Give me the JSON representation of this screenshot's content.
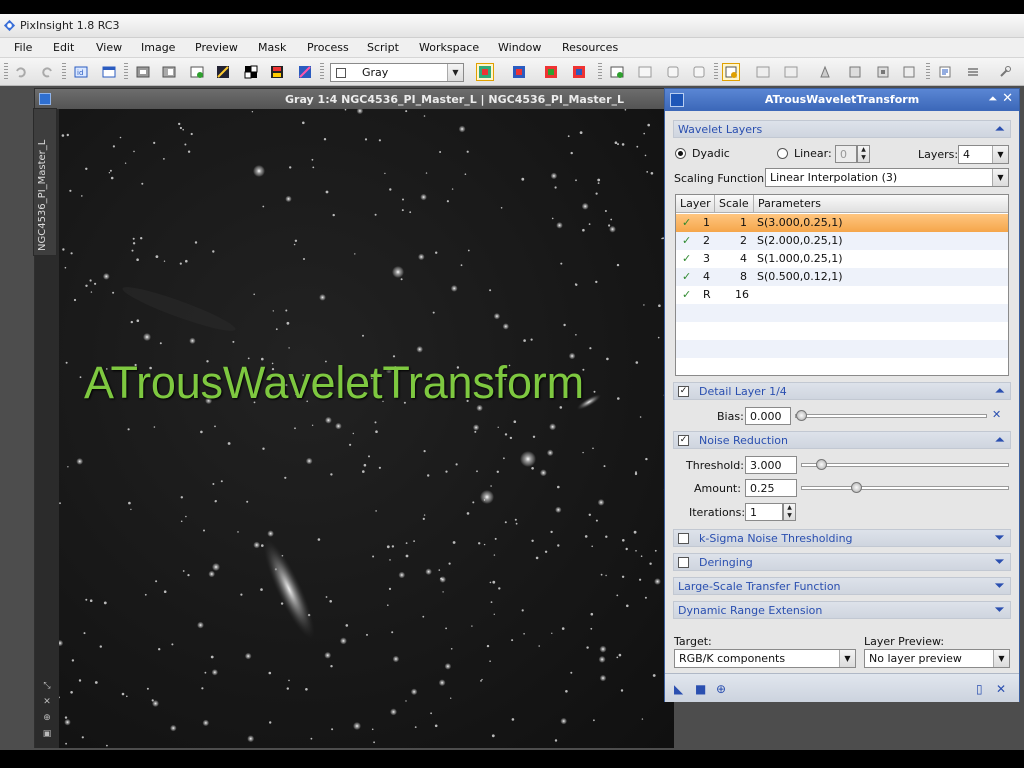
{
  "app": {
    "title": "PixInsight 1.8 RC3"
  },
  "menu": [
    "File",
    "Edit",
    "View",
    "Image",
    "Preview",
    "Mask",
    "Process",
    "Script",
    "Workspace",
    "Window",
    "Resources"
  ],
  "toolbar": {
    "color_mode": "Gray"
  },
  "image_window": {
    "title": "Gray 1:4 NGC4536_PI_Master_L | NGC4536_PI_Master_L",
    "side_tab": "NGC4536_PI_Master_L"
  },
  "overlay_title": "ATrousWaveletTransform",
  "panel": {
    "title": "ATrousWaveletTransform",
    "wavelet_layers": {
      "header": "Wavelet Layers",
      "dyadic_label": "Dyadic",
      "linear_label": "Linear:",
      "linear_value": "0",
      "layers_label": "Layers:",
      "layers_value": "4",
      "scaling_label": "Scaling Function:",
      "scaling_value": "Linear Interpolation (3)",
      "columns": [
        "Layer",
        "Scale",
        "Parameters"
      ],
      "rows": [
        {
          "check": "✓",
          "layer": "1",
          "scale": "1",
          "params": "S(3.000,0.25,1)"
        },
        {
          "check": "✓",
          "layer": "2",
          "scale": "2",
          "params": "S(2.000,0.25,1)"
        },
        {
          "check": "✓",
          "layer": "3",
          "scale": "4",
          "params": "S(1.000,0.25,1)"
        },
        {
          "check": "✓",
          "layer": "4",
          "scale": "8",
          "params": "S(0.500,0.12,1)"
        },
        {
          "check": "✓",
          "layer": "R",
          "scale": "16",
          "params": ""
        }
      ]
    },
    "detail_layer": {
      "header": "Detail Layer 1/4",
      "bias_label": "Bias:",
      "bias_value": "0.000",
      "bias_slider": 0.0
    },
    "noise_reduction": {
      "header": "Noise Reduction",
      "threshold_label": "Threshold:",
      "threshold_value": "3.000",
      "threshold_slider": 0.07,
      "amount_label": "Amount:",
      "amount_value": "0.25",
      "amount_slider": 0.25,
      "iterations_label": "Iterations:",
      "iterations_value": "1"
    },
    "sections": {
      "ksigma": "k-Sigma Noise Thresholding",
      "deringing": "Deringing",
      "large_scale": "Large-Scale Transfer Function",
      "dynamic_range": "Dynamic Range Extension"
    },
    "target_label": "Target:",
    "target_value": "RGB/K components",
    "layer_preview_label": "Layer Preview:",
    "layer_preview_value": "No layer preview"
  },
  "colors": {
    "accent": "#2a4fb0",
    "selection": "#f5a64a",
    "overlay_text": "#7ec840",
    "panel_header": "#3b67b8"
  }
}
